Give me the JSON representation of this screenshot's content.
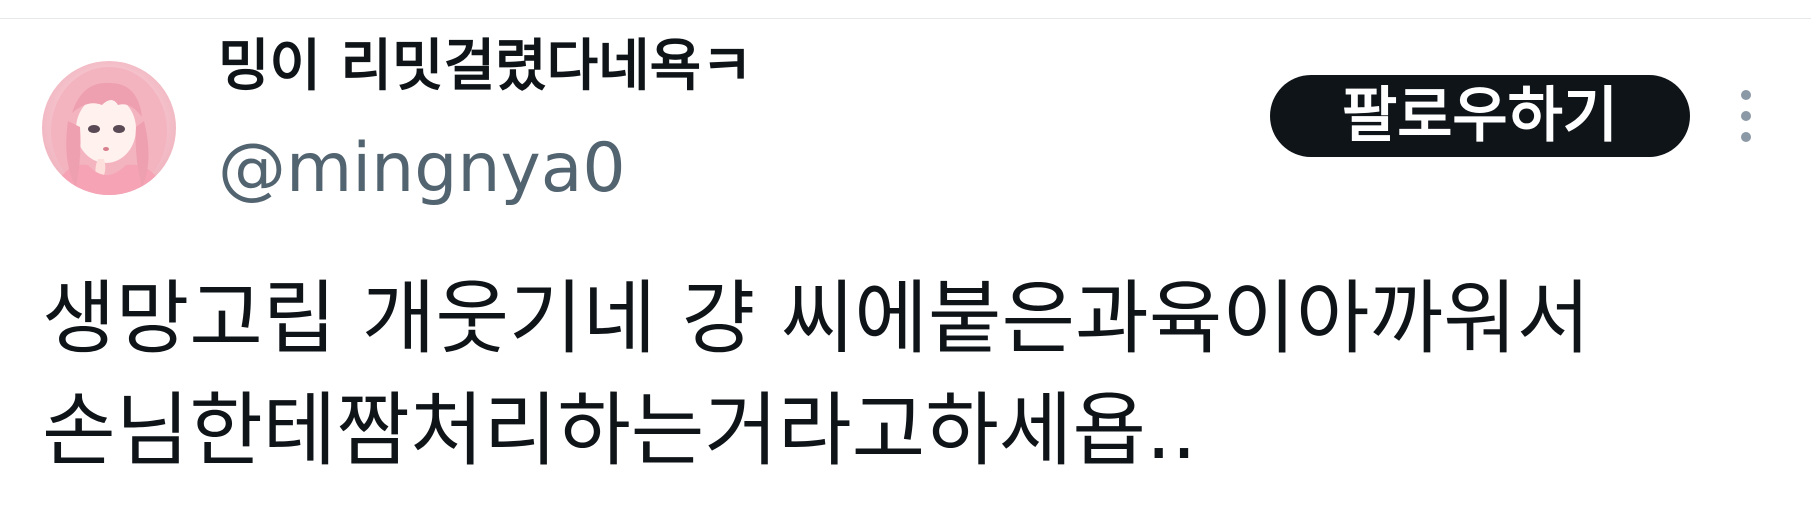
{
  "tweet": {
    "author": {
      "display_name": "밍이 리밋걸렸다네욕ㅋ",
      "handle": "@mingnya0",
      "avatar_icon": "profile-avatar"
    },
    "follow_label": "팔로우하기",
    "more_icon": "more-vertical-icon",
    "text": "생망고립 개웃기네 걍 씨에붙은과육이아까워서\n손님한테짬처리하는거라고하세욥.."
  },
  "colors": {
    "text_primary": "#0f1419",
    "text_secondary": "#536471",
    "button_bg": "#0f1419",
    "button_text": "#ffffff",
    "divider": "#e6e9ec"
  }
}
